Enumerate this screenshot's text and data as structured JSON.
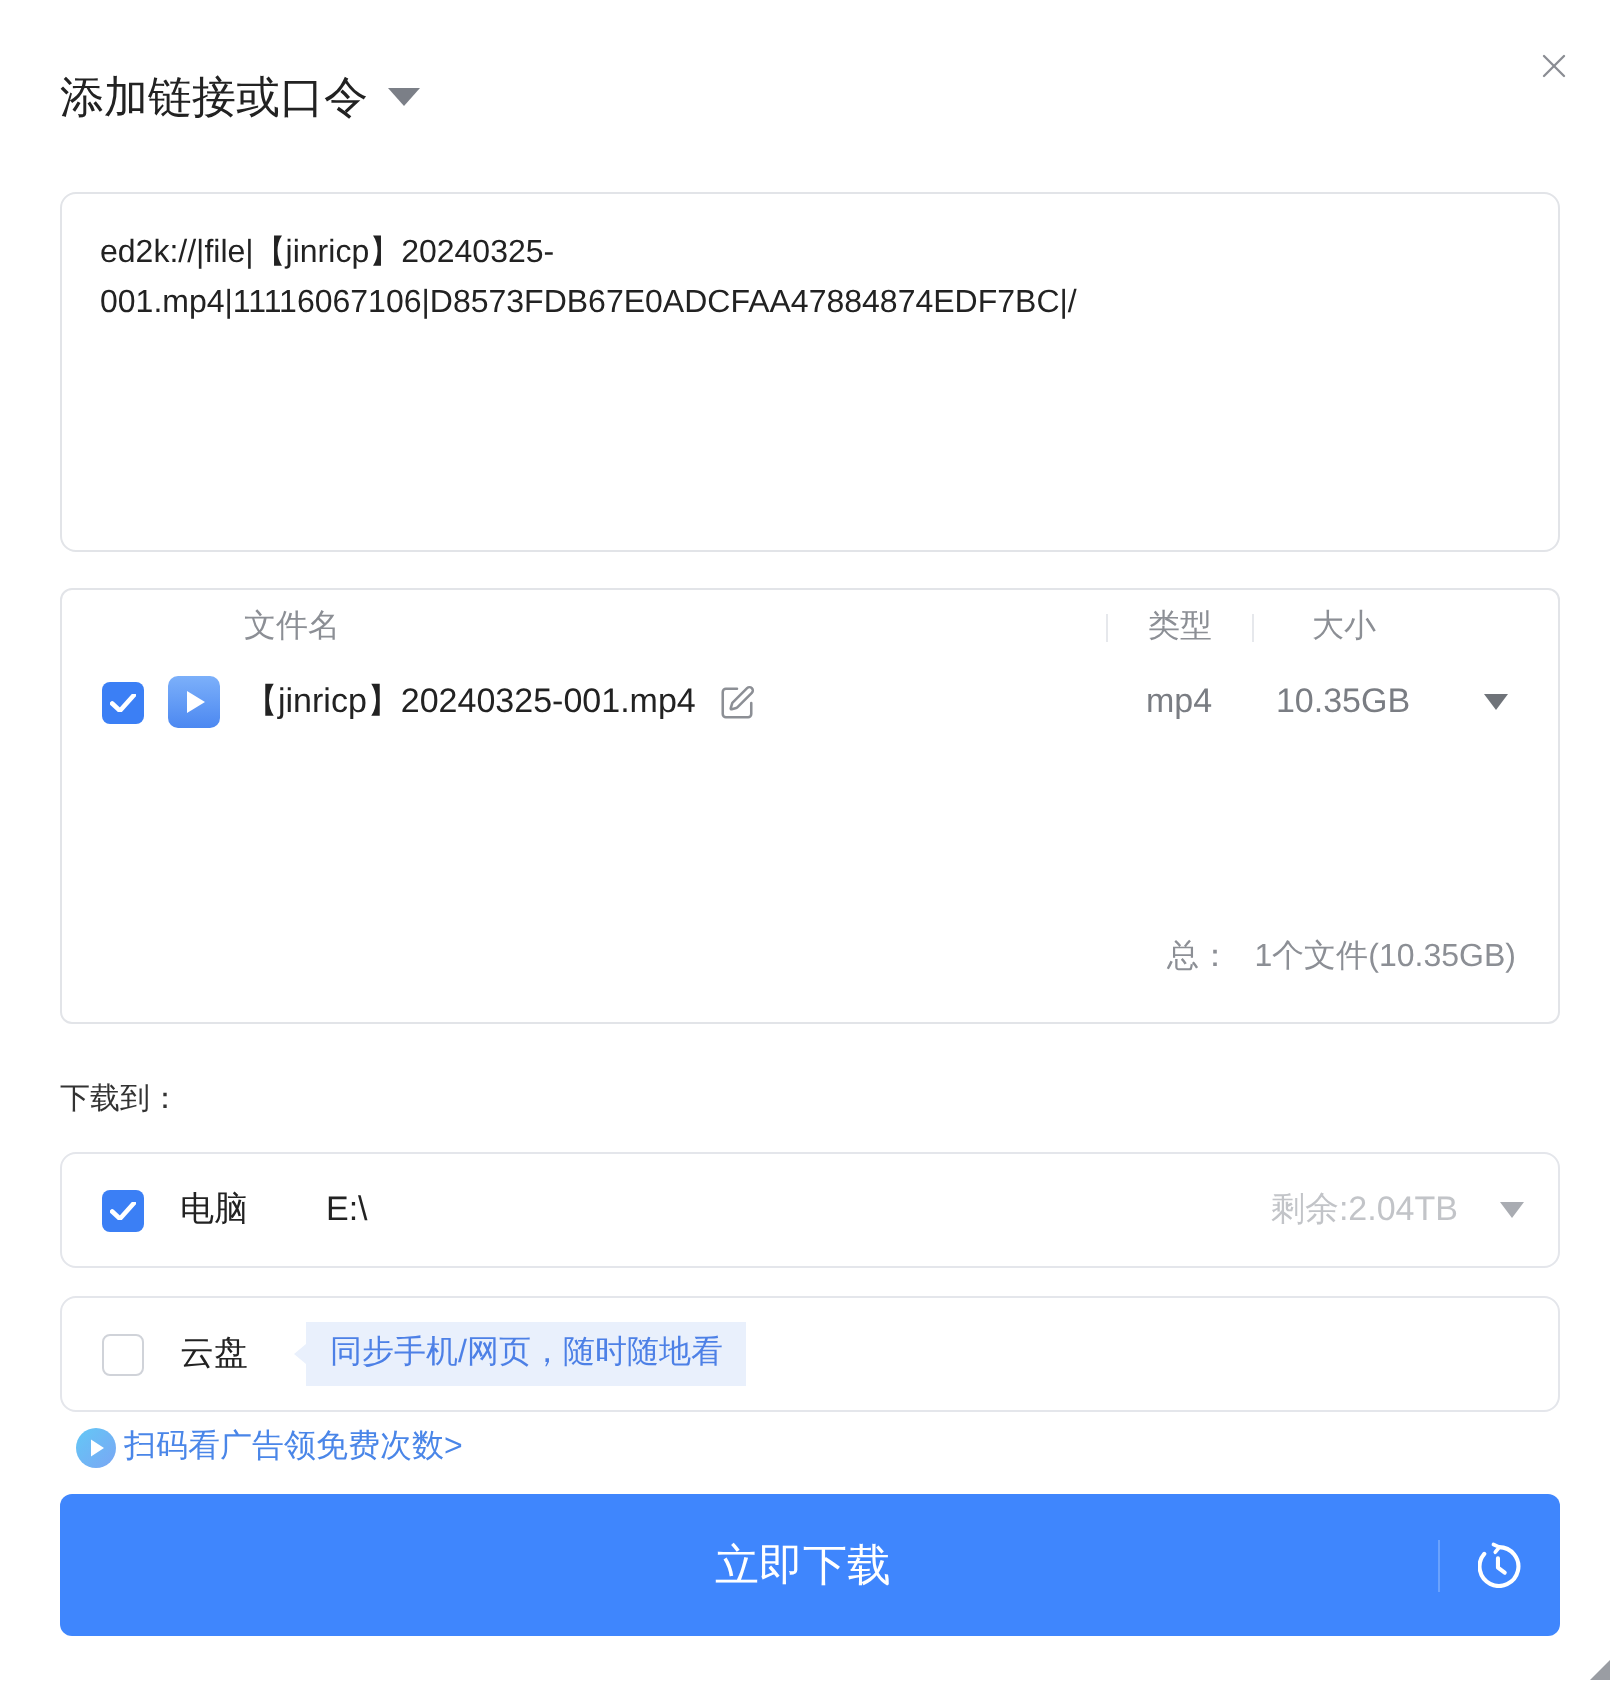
{
  "dialog": {
    "title": "添加链接或口令",
    "link_input": {
      "value": "ed2k://|file|【jinricp】20240325-001.mp4|11116067106|D8573FDB67E0ADCFAA47884874EDF7BC|/"
    },
    "file_table": {
      "columns": [
        "文件名",
        "类型",
        "大小"
      ],
      "rows": [
        {
          "checked": true,
          "name": "【jinricp】20240325-001.mp4",
          "type": "mp4",
          "size": "10.35GB"
        }
      ],
      "total_label": "总：",
      "total_value": "1个文件(10.35GB)"
    },
    "save_to": {
      "label": "下载到：",
      "targets": [
        {
          "kind": "local",
          "checked": true,
          "label": "电脑",
          "path": "E:\\",
          "free_space": "剩余:2.04TB"
        },
        {
          "kind": "cloud",
          "checked": false,
          "label": "云盘",
          "hint": "同步手机/网页，随时随地看"
        }
      ]
    },
    "promo_link": "扫码看广告领免费次数>",
    "download_button": "立即下载"
  }
}
